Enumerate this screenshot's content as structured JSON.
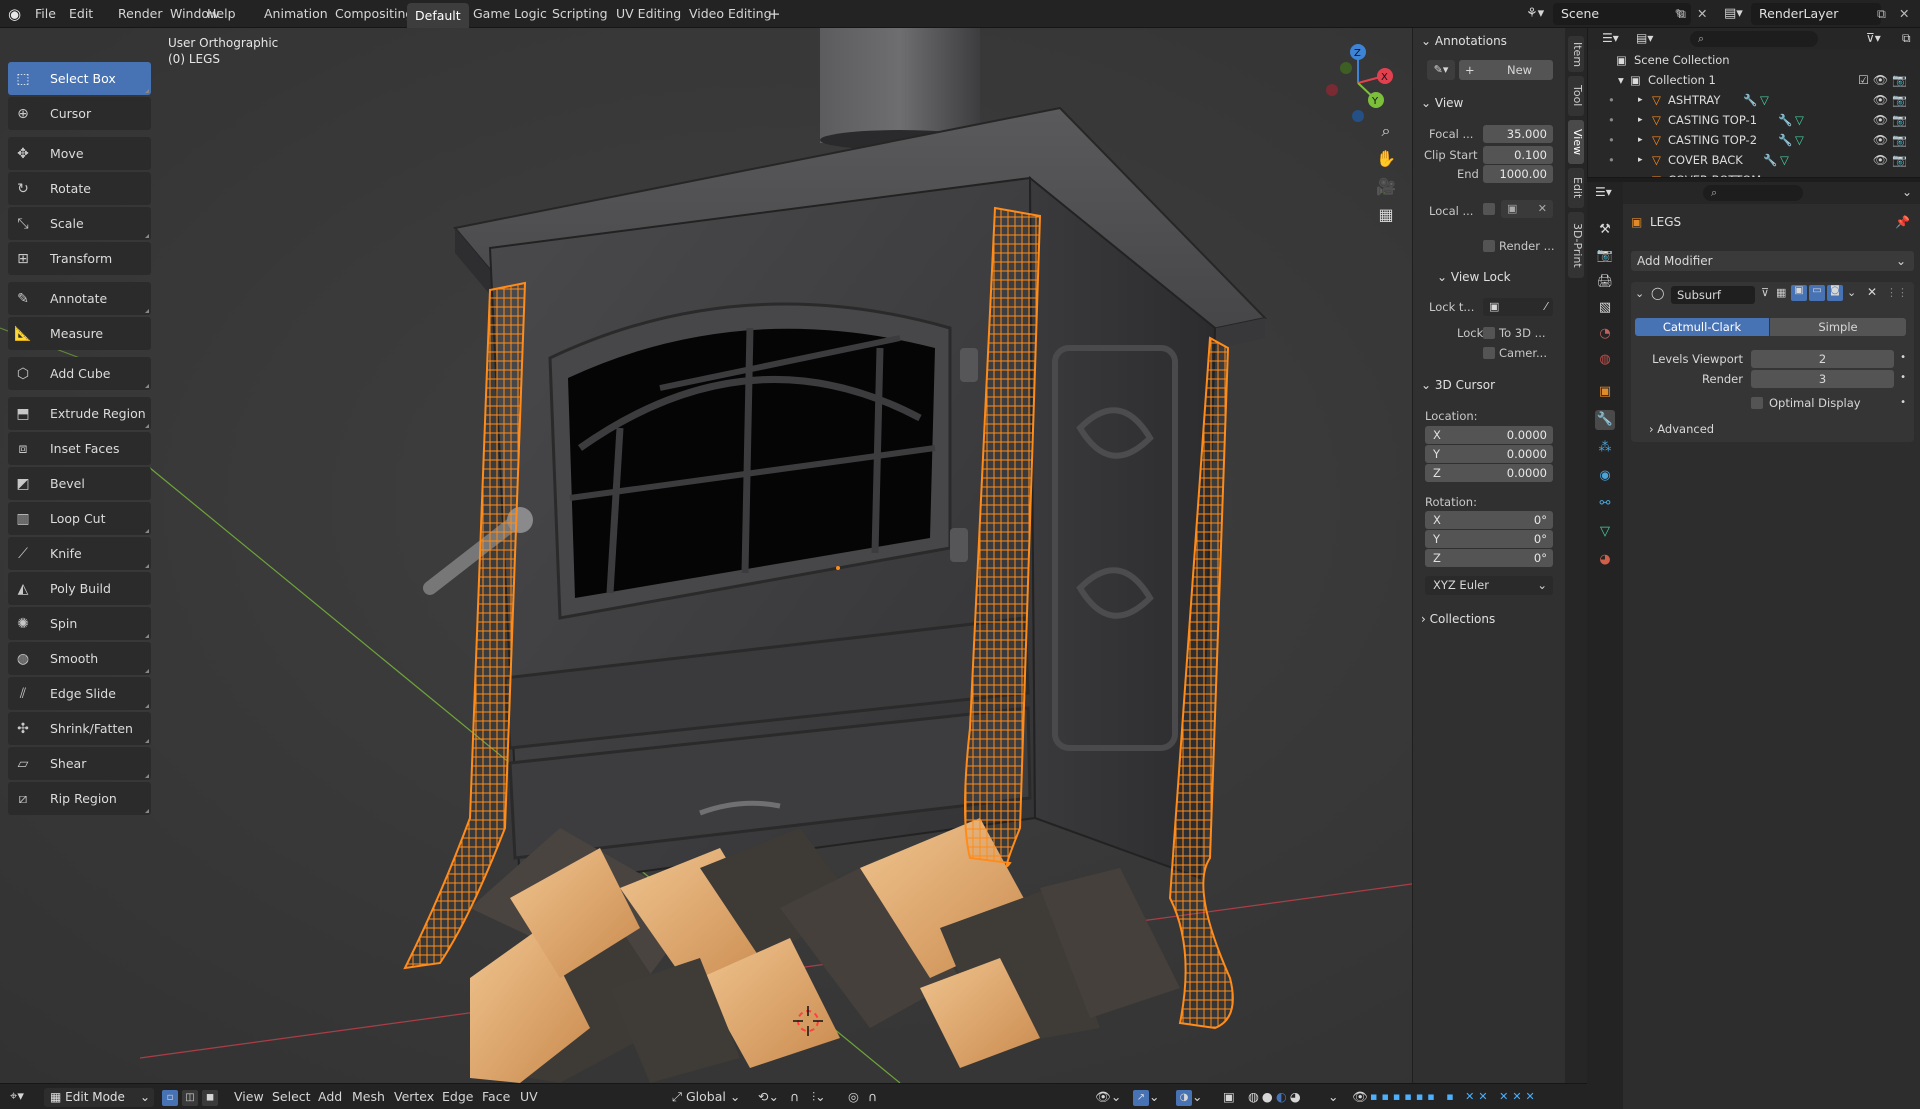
{
  "menu": {
    "file": "File",
    "edit": "Edit",
    "render": "Render",
    "window": "Window",
    "help": "Help"
  },
  "workspaces": [
    "Animation",
    "Compositing",
    "Default",
    "Game Logic",
    "Scripting",
    "UV Editing",
    "Video Editing"
  ],
  "active_workspace": "Default",
  "scene": {
    "name": "Scene",
    "render_layer": "RenderLayer"
  },
  "viewport": {
    "view_name": "User Orthographic",
    "object_info": "(0) LEGS"
  },
  "toolbar": {
    "select_box": "Select Box",
    "cursor": "Cursor",
    "move": "Move",
    "rotate": "Rotate",
    "scale": "Scale",
    "transform": "Transform",
    "annotate": "Annotate",
    "measure": "Measure",
    "add_cube": "Add Cube",
    "extrude_region": "Extrude Region",
    "inset_faces": "Inset Faces",
    "bevel": "Bevel",
    "loop_cut": "Loop Cut",
    "knife": "Knife",
    "poly_build": "Poly Build",
    "spin": "Spin",
    "smooth": "Smooth",
    "edge_slide": "Edge Slide",
    "shrink_fatten": "Shrink/Fatten",
    "shear": "Shear",
    "rip_region": "Rip Region"
  },
  "gizmo": {
    "x": "X",
    "y": "Y",
    "z": "Z"
  },
  "npanel": {
    "annotations": "Annotations",
    "new": "New",
    "view": "View",
    "focal_label": "Focal ...",
    "focal": "35.000",
    "clip_start_label": "Clip Start",
    "clip_start": "0.100",
    "end_label": "End",
    "clip_end": "1000.00",
    "local_label": "Local ...",
    "render_label": "Render ...",
    "view_lock": "View Lock",
    "lock_to_label": "Lock t...",
    "lock_label": "Lock",
    "to_3d": "To 3D ...",
    "camera": "Camer...",
    "cursor_3d": "3D Cursor",
    "location": "Location:",
    "rotation": "Rotation:",
    "loc": {
      "x": "0.0000",
      "y": "0.0000",
      "z": "0.0000"
    },
    "rot": {
      "x": "0°",
      "y": "0°",
      "z": "0°"
    },
    "axis_x": "X",
    "axis_y": "Y",
    "axis_z": "Z",
    "rotation_mode": "XYZ Euler",
    "collections": "Collections"
  },
  "side_tabs": [
    "Item",
    "Tool",
    "View",
    "Edit",
    "3D-Print"
  ],
  "active_side_tab": "View",
  "outliner": {
    "scene_collection": "Scene Collection",
    "collection": "Collection 1",
    "objects": [
      "ASHTRAY",
      "CASTING TOP-1",
      "CASTING TOP-2",
      "COVER BACK",
      "COVER BOTTOM"
    ]
  },
  "properties": {
    "object_name": "LEGS",
    "add_modifier": "Add Modifier",
    "modifier_name": "Subsurf",
    "catmull_clark": "Catmull-Clark",
    "simple": "Simple",
    "levels_viewport_label": "Levels Viewport",
    "levels_viewport": "2",
    "render_label": "Render",
    "render": "3",
    "optimal_display": "Optimal Display",
    "advanced": "Advanced"
  },
  "bottom": {
    "mode": "Edit Mode",
    "view": "View",
    "select": "Select",
    "add": "Add",
    "mesh": "Mesh",
    "vertex": "Vertex",
    "edge": "Edge",
    "face": "Face",
    "uv": "UV",
    "orientation": "Global"
  },
  "colors": {
    "accent": "#4772b3",
    "selection_orange": "#ff8c1a",
    "axis_x": "#e3404f",
    "axis_y": "#7bbf3a",
    "axis_z": "#3d84d6"
  }
}
